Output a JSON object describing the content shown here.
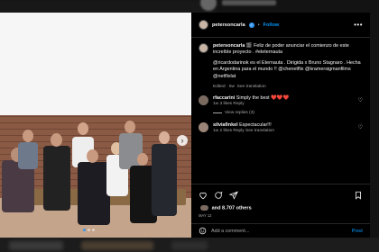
{
  "post": {
    "username": "petersoncarla",
    "follow_label": "Follow",
    "more_label": "•••",
    "caption_lines": [
      "🎬 Feliz de poder anunciar el comienzo de este increíble proyecto . #eleternauta",
      "@ricardodarinok es el Eternauta . Dirigida x Bruno Stagnaro . Hecha en Argentina para el mundo !! @chenetflix @kramersigmanfilms @netflixlat"
    ],
    "caption_meta": {
      "time": "Edited · 5w",
      "translate": "See translation"
    }
  },
  "comments": [
    {
      "username": "rfaccarini",
      "text": "Simply the best",
      "hearts": "❤️❤️❤️",
      "meta": "1w  3 likes  Reply",
      "replies": "View replies (3)"
    },
    {
      "username": "silviafinkel",
      "text": "Espectacular!!!",
      "meta": "1w  2 likes  Reply  See translation"
    }
  ],
  "actions": {
    "likes_text": "and 8.707 others",
    "date": "MAY 12"
  },
  "composer": {
    "placeholder": "Add a comment...",
    "post_label": "Post"
  },
  "colors": {
    "accent": "#0095f6",
    "panel_bg": "#000000",
    "heart": "#ff3040"
  },
  "icons": [
    "verified-icon",
    "more-icon",
    "heart-icon",
    "comment-icon",
    "share-icon",
    "bookmark-icon",
    "emoji-icon",
    "next-arrow-icon"
  ]
}
